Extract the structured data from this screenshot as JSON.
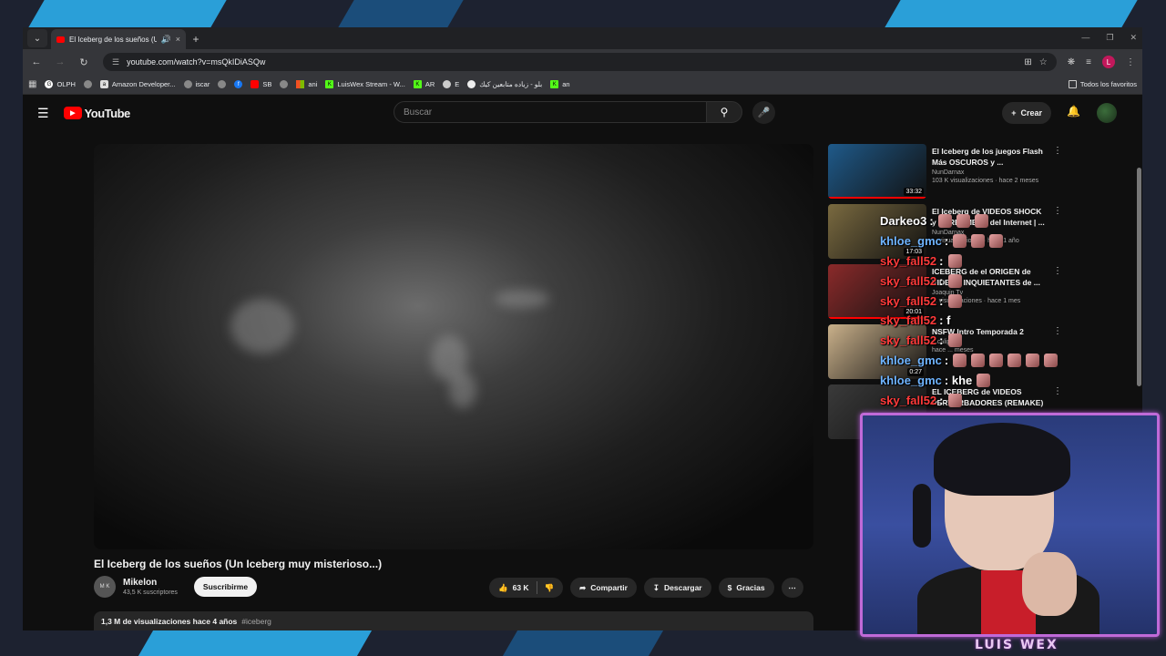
{
  "browser": {
    "tab_title": "El Iceberg de los sueños (Un",
    "url": "youtube.com/watch?v=msQkIDiASQw",
    "bookmarks": [
      "OLPH",
      "",
      "Amazon Developer...",
      "iscar",
      "",
      "",
      "SB",
      "",
      "ani",
      "LuisWex Stream - W...",
      "AR",
      "E",
      "بلو - زياده متابعين كيك",
      "an"
    ],
    "all_favorites": "Todos los favoritos",
    "profile_initial": "L"
  },
  "youtube": {
    "logo": "YouTube",
    "search_placeholder": "Buscar",
    "create_label": "Crear",
    "video_title": "El Iceberg de los sueños (Un Iceberg muy misterioso...)",
    "channel_name": "Mikelon",
    "subscribers": "43,5 K suscriptores",
    "channel_avatar_text": "M K",
    "subscribe_label": "Suscribirme",
    "likes": "63 K",
    "share_label": "Compartir",
    "download_label": "Descargar",
    "thanks_label": "Gracias",
    "description_stats": "1,3 M de visualizaciones  hace 4 años",
    "description_tag": "#iceberg"
  },
  "recommendations": [
    {
      "title": "El Iceberg de los juegos Flash Más OSCUROS y ...",
      "channel": "NunDarnax",
      "views": "103 K visualizaciones · hace 2 meses",
      "duration": "33:32",
      "progress": 1.0,
      "thumb_color": "#1f5a8a"
    },
    {
      "title": "El Iceberg de VIDEOS SHOCK y SCREAMERS del Internet | ...",
      "channel": "NunDarnax",
      "views": "... visualizaciones · hace 1 año",
      "duration": "17:03",
      "progress": 0.0,
      "thumb_color": "#7a6a40"
    },
    {
      "title": "ICEBERG de el ORIGEN de VIDEOS INQUIETANTES de ...",
      "channel": "Joaquin Tv",
      "views": "... visualizaciones · hace 1 mes",
      "duration": "20:01",
      "progress": 1.0,
      "thumb_color": "#8a2a2a"
    },
    {
      "title": "NSFW Intro Temporada 2",
      "channel": "...calipsis",
      "views": "hace ... meses",
      "duration": "0:27",
      "progress": 0.0,
      "thumb_color": "#c9b08a"
    },
    {
      "title": "EL ICEBERG de VIDEOS PERTURBADORES (REMAKE)",
      "channel": "",
      "views": "",
      "duration": "",
      "progress": 0.0,
      "thumb_color": "#3a3a3a"
    }
  ],
  "chat": [
    {
      "user": "Darkeo3",
      "msg": ":",
      "emotes": 3,
      "color": "white"
    },
    {
      "user": "khloe_gmc",
      "msg": ":",
      "emotes": 3,
      "color": "blue"
    },
    {
      "user": "sky_fall52",
      "msg": ":",
      "emotes": 1,
      "color": "red"
    },
    {
      "user": "sky_fall52",
      "msg": ":",
      "emotes": 1,
      "color": "red"
    },
    {
      "user": "sky_fall52",
      "msg": ":",
      "emotes": 1,
      "color": "red"
    },
    {
      "user": "sky_fall52",
      "msg": ": f",
      "emotes": 0,
      "color": "red"
    },
    {
      "user": "sky_fall52",
      "msg": ":",
      "emotes": 1,
      "color": "red"
    },
    {
      "user": "khloe_gmc",
      "msg": ":",
      "emotes": 6,
      "color": "blue"
    },
    {
      "user": "khloe_gmc",
      "msg": ": khe",
      "emotes": 1,
      "color": "blue"
    },
    {
      "user": "sky_fall52",
      "msg": ":",
      "emotes": 1,
      "color": "red"
    }
  ],
  "stream": {
    "streamer_name": "LUIS WEX"
  },
  "colors": {
    "yt_red": "#ff0000",
    "cam_border": "#c06ad8",
    "overlay_blue": "#2a9fd8"
  }
}
